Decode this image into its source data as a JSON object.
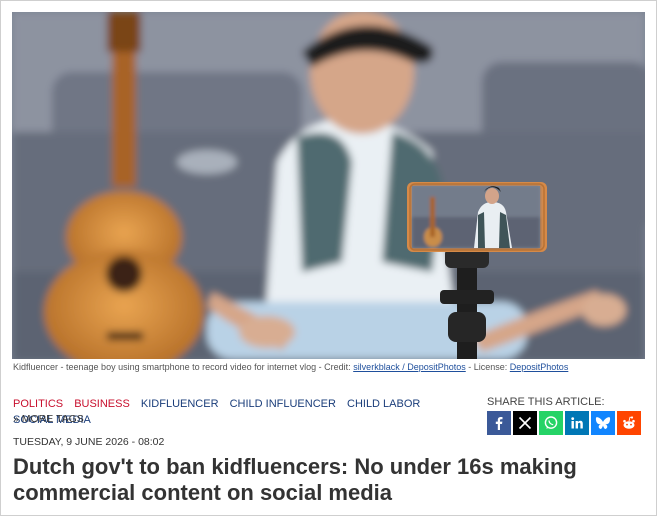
{
  "image": {
    "caption_prefix": "Kidfluencer - teenage boy using smartphone to record video for internet vlog - Credit: ",
    "credit_link": "silverkblack / DepositPhotos",
    "license_prefix": " - License: ",
    "license_link": "DepositPhotos"
  },
  "tags": [
    {
      "label": "POLITICS",
      "color": "#c8102e"
    },
    {
      "label": "BUSINESS",
      "color": "#c8102e"
    },
    {
      "label": "KIDFLUENCER",
      "color": "#1a3d7a"
    },
    {
      "label": "CHILD INFLUENCER",
      "color": "#1a3d7a"
    },
    {
      "label": "CHILD LABOR",
      "color": "#1a3d7a"
    },
    {
      "label": "SOCIAL MEDIA",
      "color": "#1a3d7a"
    }
  ],
  "more_tags": "» MORE TAGS",
  "share": {
    "label": "SHARE THIS ARTICLE:",
    "buttons": [
      {
        "icon": "facebook-icon",
        "color": "#3b5998"
      },
      {
        "icon": "x-icon",
        "color": "#000000"
      },
      {
        "icon": "whatsapp-icon",
        "color": "#25d366"
      },
      {
        "icon": "linkedin-icon",
        "color": "#0077b5"
      },
      {
        "icon": "bluesky-icon",
        "color": "#1185fe"
      },
      {
        "icon": "reddit-icon",
        "color": "#ff4500"
      }
    ]
  },
  "article": {
    "date": "TUESDAY, 9 JUNE 2026 - 08:02",
    "title": "Dutch gov't to ban kidfluencers: No under 16s making commercial content on social media"
  }
}
